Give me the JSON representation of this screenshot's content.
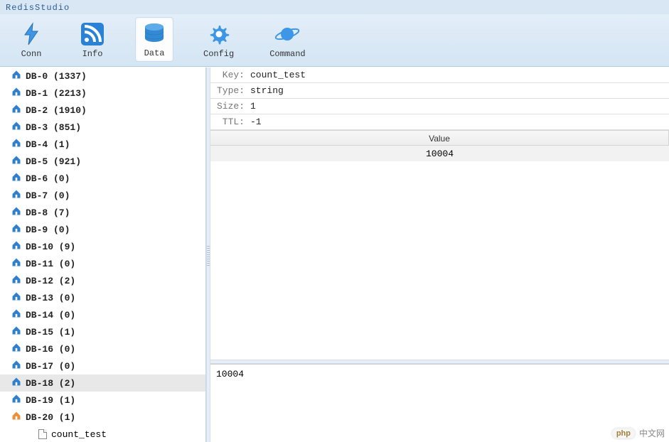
{
  "app_title": "RedisStudio",
  "toolbar": {
    "items": [
      {
        "label": "Conn"
      },
      {
        "label": "Info"
      },
      {
        "label": "Data",
        "active": true
      },
      {
        "label": "Config"
      },
      {
        "label": "Command"
      }
    ]
  },
  "sidebar": {
    "databases": [
      {
        "name": "DB-0",
        "count": 1337,
        "open": false
      },
      {
        "name": "DB-1",
        "count": 2213,
        "open": false
      },
      {
        "name": "DB-2",
        "count": 1910,
        "open": false
      },
      {
        "name": "DB-3",
        "count": 851,
        "open": false
      },
      {
        "name": "DB-4",
        "count": 1,
        "open": false
      },
      {
        "name": "DB-5",
        "count": 921,
        "open": false
      },
      {
        "name": "DB-6",
        "count": 0,
        "open": false
      },
      {
        "name": "DB-7",
        "count": 0,
        "open": false
      },
      {
        "name": "DB-8",
        "count": 7,
        "open": false
      },
      {
        "name": "DB-9",
        "count": 0,
        "open": false
      },
      {
        "name": "DB-10",
        "count": 9,
        "open": false
      },
      {
        "name": "DB-11",
        "count": 0,
        "open": false
      },
      {
        "name": "DB-12",
        "count": 2,
        "open": false
      },
      {
        "name": "DB-13",
        "count": 0,
        "open": false
      },
      {
        "name": "DB-14",
        "count": 0,
        "open": false
      },
      {
        "name": "DB-15",
        "count": 1,
        "open": false
      },
      {
        "name": "DB-16",
        "count": 0,
        "open": false
      },
      {
        "name": "DB-17",
        "count": 0,
        "open": false
      },
      {
        "name": "DB-18",
        "count": 2,
        "open": false,
        "selected": true
      },
      {
        "name": "DB-19",
        "count": 1,
        "open": false
      },
      {
        "name": "DB-20",
        "count": 1,
        "open": true,
        "keys": [
          "count_test"
        ]
      }
    ]
  },
  "detail": {
    "labels": {
      "key": "Key:",
      "type": "Type:",
      "size": "Size:",
      "ttl": "TTL:"
    },
    "key": "count_test",
    "type": "string",
    "size": "1",
    "ttl": "-1",
    "table": {
      "header": "Value",
      "rows": [
        "10004"
      ]
    },
    "raw": "10004"
  },
  "watermark": {
    "badge": "php",
    "text": "中文网"
  }
}
